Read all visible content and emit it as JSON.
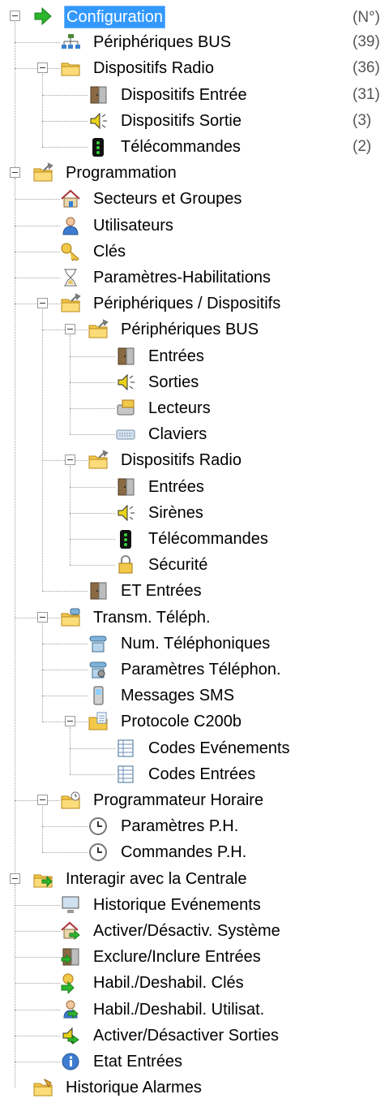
{
  "header": {
    "count_column_label": "(N°)"
  },
  "items": [
    {
      "label": "Configuration",
      "level": 0,
      "icon": "green-arrow-icon",
      "expanded": true,
      "selected": true
    },
    {
      "label": "Périphériques BUS",
      "level": 1,
      "icon": "network-icon",
      "count": "(39)"
    },
    {
      "label": "Dispositifs Radio",
      "level": 1,
      "icon": "folder-icon",
      "expanded": true,
      "count": "(36)"
    },
    {
      "label": "Dispositifs Entrée",
      "level": 2,
      "icon": "door-icon",
      "count": "(31)"
    },
    {
      "label": "Dispositifs Sortie",
      "level": 2,
      "icon": "speaker-icon",
      "count": "(3)"
    },
    {
      "label": "Télécommandes",
      "level": 2,
      "icon": "remote-control-icon",
      "count": "(2)"
    },
    {
      "label": "Programmation",
      "level": 0,
      "icon": "folder-wrench-icon",
      "expanded": true
    },
    {
      "label": "Secteurs et  Groupes",
      "level": 1,
      "icon": "house-icon"
    },
    {
      "label": "Utilisateurs",
      "level": 1,
      "icon": "user-icon"
    },
    {
      "label": "Clés",
      "level": 1,
      "icon": "key-icon"
    },
    {
      "label": "Paramètres-Habilitations",
      "level": 1,
      "icon": "hourglass-icon"
    },
    {
      "label": "Périphériques / Dispositifs",
      "level": 1,
      "icon": "folder-wrench-icon",
      "expanded": true
    },
    {
      "label": "Périphériques BUS",
      "level": 2,
      "icon": "folder-wrench-icon",
      "expanded": true
    },
    {
      "label": "Entrées",
      "level": 3,
      "icon": "door-icon"
    },
    {
      "label": "Sorties",
      "level": 3,
      "icon": "speaker-icon"
    },
    {
      "label": "Lecteurs",
      "level": 3,
      "icon": "card-reader-icon"
    },
    {
      "label": "Claviers",
      "level": 3,
      "icon": "keyboard-icon"
    },
    {
      "label": "Dispositifs Radio",
      "level": 2,
      "icon": "folder-wrench-icon",
      "expanded": true
    },
    {
      "label": "Entrées",
      "level": 3,
      "icon": "door-icon"
    },
    {
      "label": "Sirènes",
      "level": 3,
      "icon": "speaker-icon"
    },
    {
      "label": "Télécommandes",
      "level": 3,
      "icon": "remote-control-icon"
    },
    {
      "label": "Sécurité",
      "level": 3,
      "icon": "lock-icon"
    },
    {
      "label": "ET Entrées",
      "level": 2,
      "icon": "door-icon"
    },
    {
      "label": "Transm. Téléph.",
      "level": 1,
      "icon": "folder-phone-icon",
      "expanded": true
    },
    {
      "label": "Num. Téléphoniques",
      "level": 2,
      "icon": "phone-icon"
    },
    {
      "label": "Paramètres Téléphon.",
      "level": 2,
      "icon": "phone-settings-icon"
    },
    {
      "label": "Messages SMS",
      "level": 2,
      "icon": "mobile-phone-icon"
    },
    {
      "label": "Protocole C200b",
      "level": 2,
      "icon": "folder-document-icon",
      "expanded": true
    },
    {
      "label": "Codes Evénements",
      "level": 3,
      "icon": "table-icon"
    },
    {
      "label": "Codes Entrées",
      "level": 3,
      "icon": "table-icon"
    },
    {
      "label": "Programmateur Horaire",
      "level": 1,
      "icon": "folder-clock-icon",
      "expanded": true
    },
    {
      "label": "Paramètres P.H.",
      "level": 2,
      "icon": "clock-icon"
    },
    {
      "label": "Commandes P.H.",
      "level": 2,
      "icon": "clock-icon"
    },
    {
      "label": "Interagir avec la Centrale",
      "level": 0,
      "icon": "folder-arrow-icon",
      "expanded": true
    },
    {
      "label": "Historique Evénements",
      "level": 1,
      "icon": "computer-icon"
    },
    {
      "label": "Activer/Désactiv. Système",
      "level": 1,
      "icon": "house-arrow-icon"
    },
    {
      "label": "Exclure/Inclure Entrées",
      "level": 1,
      "icon": "door-arrow-icon"
    },
    {
      "label": "Habil./Deshabil. Clés",
      "level": 1,
      "icon": "key-arrow-icon"
    },
    {
      "label": "Habil./Deshabil. Utilisat.",
      "level": 1,
      "icon": "user-arrow-icon"
    },
    {
      "label": "Activer/Désactiver Sorties",
      "level": 1,
      "icon": "speaker-arrow-icon"
    },
    {
      "label": "Etat Entrées",
      "level": 1,
      "icon": "info-icon"
    },
    {
      "label": "Historique Alarmes",
      "level": 0,
      "icon": "folder-bell-icon"
    }
  ]
}
